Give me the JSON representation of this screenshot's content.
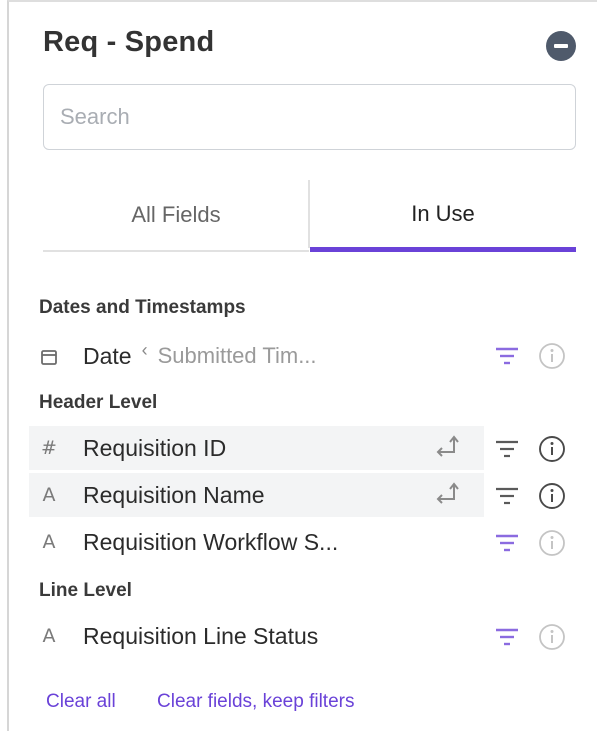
{
  "panel": {
    "title": "Req - Spend",
    "collapse_icon": "minus-circle-icon"
  },
  "search": {
    "placeholder": "Search",
    "value": ""
  },
  "tabs": [
    {
      "label": "All Fields",
      "active": false
    },
    {
      "label": "In Use",
      "active": true
    }
  ],
  "sections": [
    {
      "title": "Dates and Timestamps",
      "fields": [
        {
          "type_icon": "calendar-icon",
          "label": "Date",
          "sub_label": "Submitted Tim...",
          "filter_active": true,
          "info_active": false
        }
      ]
    },
    {
      "title": "Header Level",
      "fields": [
        {
          "type_icon": "#",
          "label": "Requisition ID",
          "pivot": true,
          "filter_active": false,
          "info_active": true
        },
        {
          "type_icon": "A",
          "label": "Requisition Name",
          "pivot": true,
          "filter_active": false,
          "info_active": true
        },
        {
          "type_icon": "A",
          "label": "Requisition Workflow S...",
          "pivot": false,
          "filter_active": true,
          "info_active": false
        }
      ]
    },
    {
      "title": "Line Level",
      "fields": [
        {
          "type_icon": "A",
          "label": "Requisition Line Status",
          "pivot": false,
          "filter_active": true,
          "info_active": false
        }
      ]
    }
  ],
  "footer": {
    "clear_all": "Clear all",
    "clear_fields_keep_filters": "Clear fields, keep filters"
  },
  "colors": {
    "accent": "#6a42d8",
    "filter_active": "#8b6be0",
    "icon_muted": "#c4c4c4",
    "icon_dark": "#5a5a5a"
  }
}
